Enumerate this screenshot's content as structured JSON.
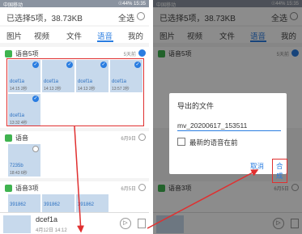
{
  "status": {
    "carrier": "中国移动",
    "right": "☉44% 15:35"
  },
  "header": {
    "title": "已选择5项，38.73KB",
    "select_all": "全选"
  },
  "tabs": [
    "图片",
    "视频",
    "文件",
    "语音",
    "我的"
  ],
  "groups": [
    {
      "title": "语音5项",
      "date": "5天前"
    },
    {
      "title": "语音",
      "date": "6月9日"
    },
    {
      "title": "语音3项",
      "date": "6月5日"
    }
  ],
  "tiles": [
    {
      "name": "dcef1a",
      "time": "14:15 2秒"
    },
    {
      "name": "dcef1a",
      "time": "14:13 2秒"
    },
    {
      "name": "dcef1a",
      "time": "14:13 2秒"
    },
    {
      "name": "dcef1a",
      "time": "13:57 2秒"
    },
    {
      "name": "dcef1a",
      "time": "13:32 4秒"
    }
  ],
  "group2_tile": {
    "name": "7235b",
    "time": "18:43 6秒"
  },
  "group3_tiles": [
    {
      "name": "391862"
    },
    {
      "name": "391862"
    },
    {
      "name": "391862"
    }
  ],
  "player": {
    "name": "dcef1a",
    "time": "4月12日 14:12"
  },
  "dialog": {
    "title": "导出的文件",
    "filename": "mv_20200617_153511",
    "checkbox_label": "最新的语音在前",
    "cancel": "取消",
    "ok": "合成"
  },
  "colors": {
    "accent": "#2a7de1",
    "highlight": "#e03030",
    "wechat_green": "#3fb34f"
  }
}
